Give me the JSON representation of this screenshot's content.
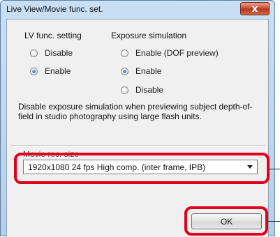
{
  "window": {
    "title": "Live View/Movie func. set.",
    "close_label": "x"
  },
  "lv_func": {
    "heading": "LV func. setting",
    "options": [
      {
        "label": "Disable",
        "selected": false
      },
      {
        "label": "Enable",
        "selected": true
      }
    ]
  },
  "exposure_sim": {
    "heading": "Exposure simulation",
    "options": [
      {
        "label": "Enable (DOF preview)",
        "selected": false
      },
      {
        "label": "Enable",
        "selected": true
      },
      {
        "label": "Disable",
        "selected": false
      }
    ]
  },
  "note": "Disable exposure simulation when previewing subject depth-of-field in studio photography using large flash units.",
  "movie_rec": {
    "label": "Movie rec. size",
    "selected": "1920x1080  24 fps High comp. (inter frame, IPB)"
  },
  "buttons": {
    "ok_label": "OK"
  },
  "colors": {
    "highlight": "#e0001b",
    "radio_selected": "#1a5fb4"
  }
}
